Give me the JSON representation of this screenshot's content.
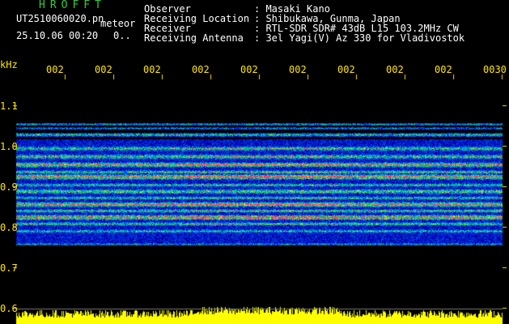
{
  "header": {
    "brand": "HROFFT",
    "filename": "UT2510060020.pn",
    "mode": "meteor",
    "datetime": "25.10.06 00:20",
    "counter": "0..",
    "info_labels": [
      "Observer",
      "Receiving Location",
      "Receiver",
      "Receiving Antenna"
    ],
    "info_values": [
      ": Masaki Kano",
      ": Shibukawa, Gunma, Japan",
      ": RTL-SDR SDR# 43dB L15 103.2MHz CW",
      ": 3el Yagi(V) Az 330 for Vladivostok"
    ]
  },
  "axis": {
    "unit": "kHz",
    "y_ticks": [
      "1.1",
      "1.0",
      "0.9",
      "0.8",
      "0.7",
      "0.6"
    ],
    "x_ticks": [
      "002",
      "002",
      "002",
      "002",
      "002",
      "002",
      "002",
      "002",
      "002",
      "0030"
    ]
  },
  "colors": {
    "axis_text": "#ffe600",
    "brand": "#2ecc40",
    "text": "#ffffff",
    "background": "#000000",
    "signal_trace": "#ffff00"
  }
}
